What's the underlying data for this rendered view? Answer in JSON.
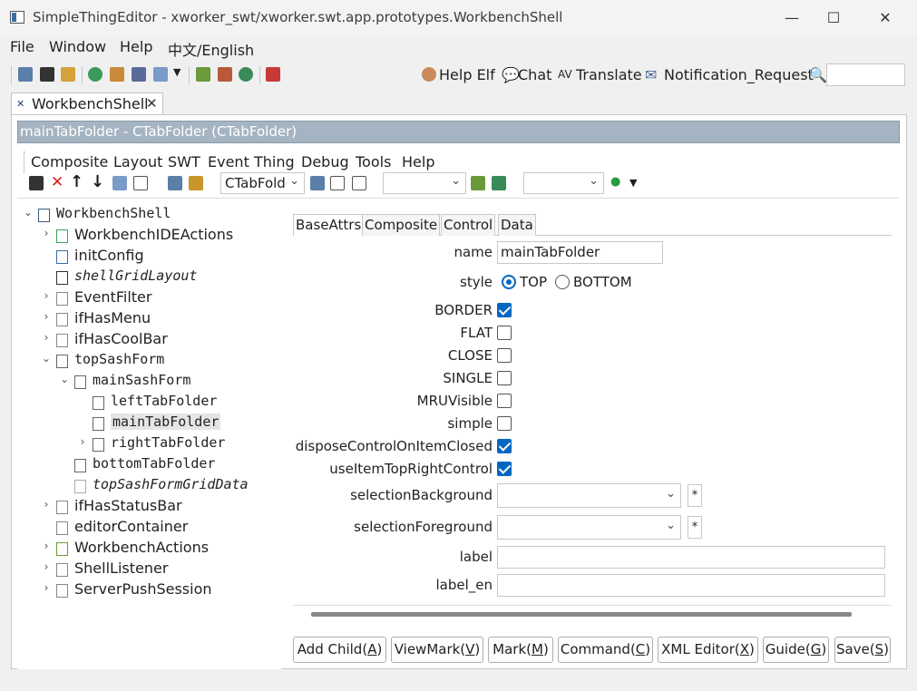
{
  "window": {
    "title": "SimpleThingEditor - xworker_swt/xworker.swt.app.prototypes.WorkbenchShell",
    "controls": {
      "minimize": "—",
      "maximize": "☐",
      "close": "✕"
    }
  },
  "menubar": [
    "File",
    "Window",
    "Help",
    "中文/English"
  ],
  "toolbar": {
    "help_elf": "Help Elf",
    "chat": "Chat",
    "translate": "Translate",
    "notification": "Notification_Request",
    "search_value": ""
  },
  "editor_tab": {
    "label": "WorkbenchShell",
    "close": "✕"
  },
  "header": {
    "title": "mainTabFolder - CTabFolder  (CTabFolder)"
  },
  "inner_menu": [
    "Composite",
    "Layout",
    "SWT",
    "Event",
    "Thing",
    "Debug",
    "Tools",
    "Help"
  ],
  "inner_toolbar": {
    "type_combo": "CTabFolder",
    "combo2": "",
    "combo3": ""
  },
  "tree": {
    "items": [
      {
        "label": "WorkbenchShell",
        "expander": "⌄",
        "mono": true
      },
      {
        "label": "WorkbenchIDEActions",
        "expander": "›"
      },
      {
        "label": "initConfig",
        "expander": ""
      },
      {
        "label": "shellGridLayout",
        "expander": "",
        "italic": true
      },
      {
        "label": "EventFilter",
        "expander": "›"
      },
      {
        "label": "ifHasMenu",
        "expander": "›"
      },
      {
        "label": "ifHasCoolBar",
        "expander": "›"
      },
      {
        "label": "topSashForm",
        "expander": "⌄",
        "mono": true
      },
      {
        "label": "mainSashForm",
        "expander": "⌄",
        "mono": true
      },
      {
        "label": "leftTabFolder",
        "expander": "",
        "mono": true
      },
      {
        "label": "mainTabFolder",
        "expander": "",
        "mono": true,
        "selected": true
      },
      {
        "label": "rightTabFolder",
        "expander": "›",
        "mono": true
      },
      {
        "label": "bottomTabFolder",
        "expander": "",
        "mono": true
      },
      {
        "label": "topSashFormGridData",
        "expander": "",
        "italic": true
      },
      {
        "label": "ifHasStatusBar",
        "expander": "›"
      },
      {
        "label": "editorContainer",
        "expander": ""
      },
      {
        "label": "WorkbenchActions",
        "expander": "›"
      },
      {
        "label": "ShellListener",
        "expander": "›"
      },
      {
        "label": "ServerPushSession",
        "expander": "›"
      }
    ]
  },
  "properties": {
    "tabs": [
      "BaseAttrs",
      "Composite",
      "Control",
      "Data"
    ],
    "name_label": "name",
    "name_value": "mainTabFolder",
    "style_label": "style",
    "style_options": [
      "TOP",
      "BOTTOM"
    ],
    "style_selected": "TOP",
    "checkboxes": [
      {
        "label": "BORDER",
        "checked": true
      },
      {
        "label": "FLAT",
        "checked": false
      },
      {
        "label": "CLOSE",
        "checked": false
      },
      {
        "label": "SINGLE",
        "checked": false
      },
      {
        "label": "MRUVisible",
        "checked": false
      },
      {
        "label": "simple",
        "checked": false
      },
      {
        "label": "disposeControlOnItemClosed",
        "checked": true
      },
      {
        "label": "useItemTopRightControl",
        "checked": true
      }
    ],
    "selection_background_label": "selectionBackground",
    "selection_background_value": "",
    "selection_foreground_label": "selectionForeground",
    "selection_foreground_value": "",
    "star": "*",
    "label_label": "label",
    "label_value": "",
    "label_en_label": "label_en",
    "label_en_value": ""
  },
  "buttons": [
    {
      "text": "Add Child(",
      "key": "A",
      "tail": ")"
    },
    {
      "text": "ViewMark(",
      "key": "V",
      "tail": ")"
    },
    {
      "text": "Mark(",
      "key": "M",
      "tail": ")"
    },
    {
      "text": "Command(",
      "key": "C",
      "tail": ")"
    },
    {
      "text": "XML Editor(",
      "key": "X",
      "tail": ")"
    },
    {
      "text": "Guide(",
      "key": "G",
      "tail": ")"
    },
    {
      "text": "Save(",
      "key": "S",
      "tail": ")"
    }
  ],
  "colors": {
    "accent": "#0067c0",
    "header_bar": "#a5b4c2",
    "tree_selection": "#e5e5e5"
  }
}
